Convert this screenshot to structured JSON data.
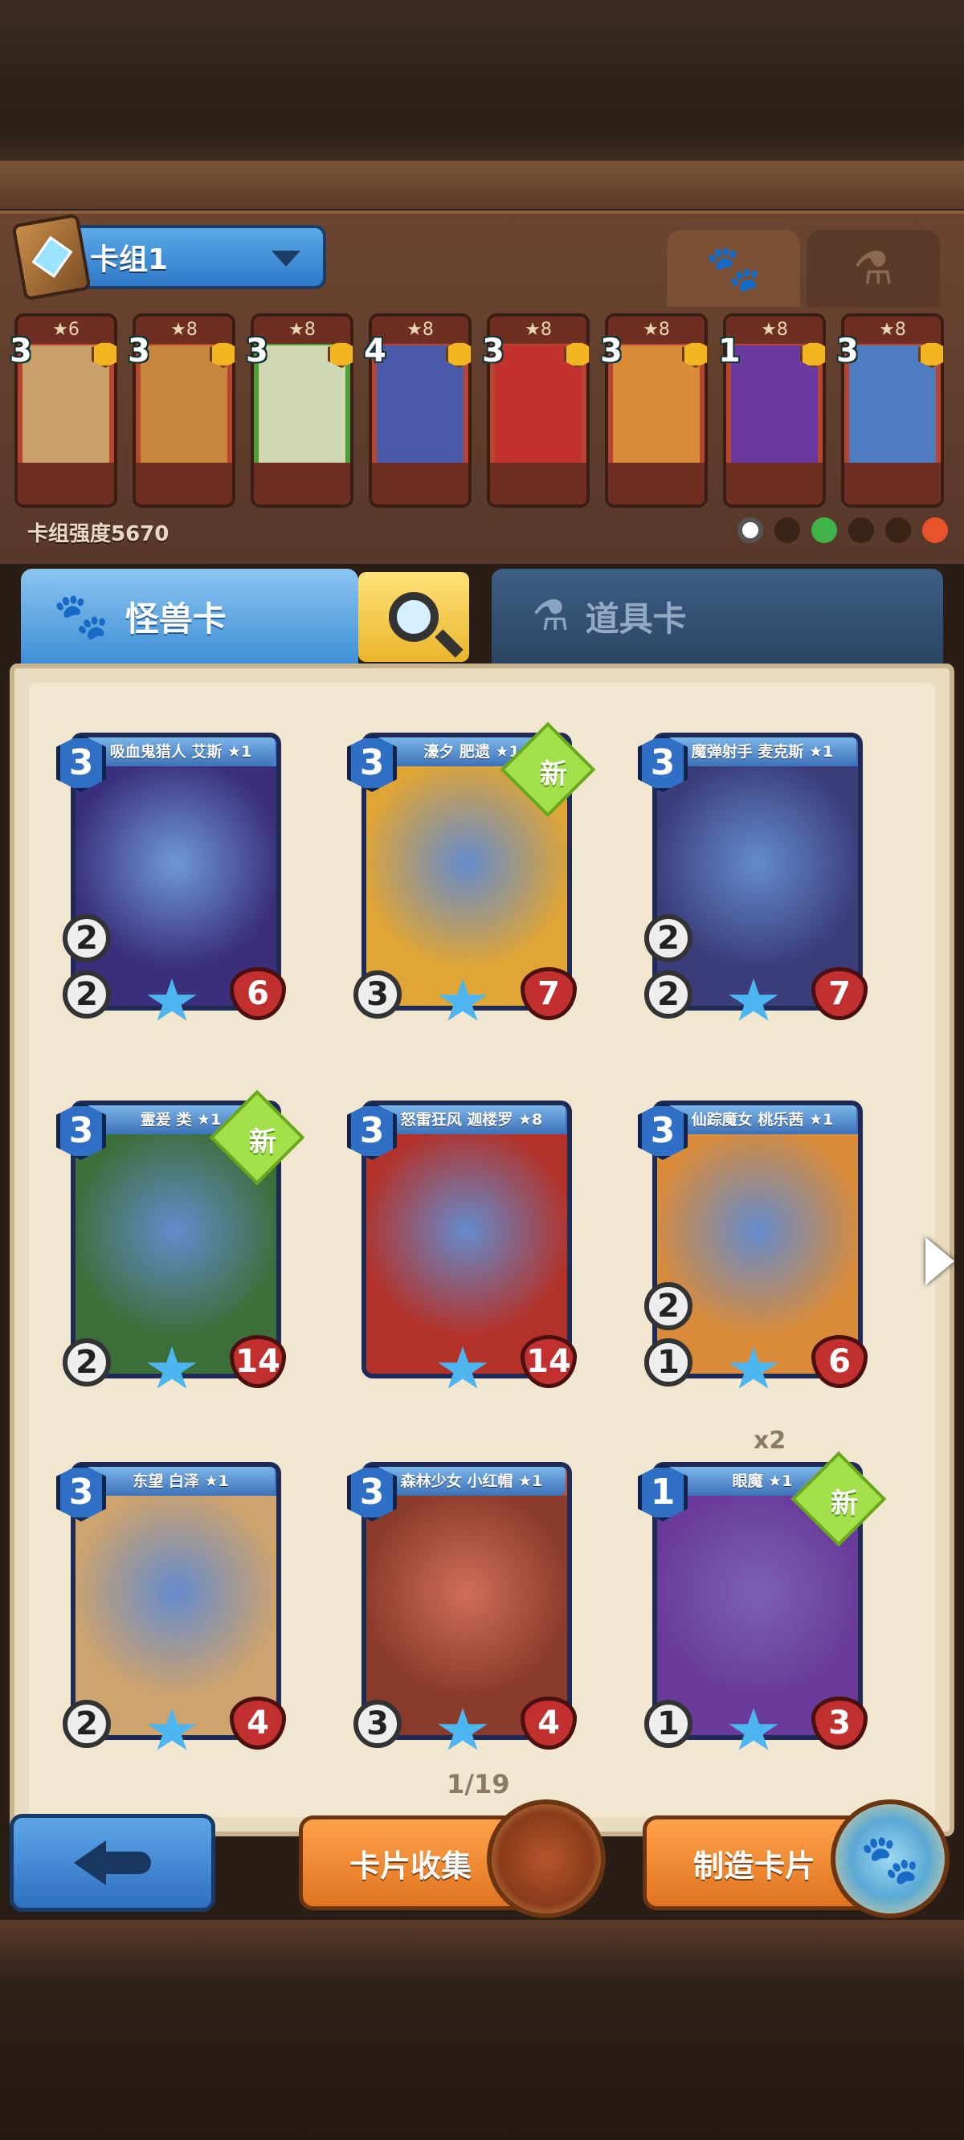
{
  "deck": {
    "name": "卡组1",
    "power_label": "卡组强度5670"
  },
  "deck_cards": [
    {
      "stars": "★6",
      "cost": "3",
      "bg": "#b8452f",
      "art": "#c9a06a"
    },
    {
      "stars": "★8",
      "cost": "3",
      "bg": "#b8452f",
      "art": "#c7873c"
    },
    {
      "stars": "★8",
      "cost": "3",
      "bg": "#4c9e35",
      "art": "#cfd7b3"
    },
    {
      "stars": "★8",
      "cost": "4",
      "bg": "#b8452f",
      "art": "#4a5aa8"
    },
    {
      "stars": "★8",
      "cost": "3",
      "bg": "#b8452f",
      "art": "#c3322f"
    },
    {
      "stars": "★8",
      "cost": "3",
      "bg": "#b8452f",
      "art": "#d98b3a"
    },
    {
      "stars": "★8",
      "cost": "1",
      "bg": "#b8452f",
      "art": "#6a3aa0"
    },
    {
      "stars": "★8",
      "cost": "3",
      "bg": "#b8452f",
      "art": "#4e7cc0"
    }
  ],
  "tabs": {
    "monster": "怪兽卡",
    "item": "道具卡"
  },
  "cards": [
    {
      "name": "吸血鬼猎人 艾斯 ★1",
      "cost": "3",
      "atk": "2",
      "def": "2",
      "hp": "6",
      "art": "#3a2f7a",
      "frame": "#4b7fd0",
      "new": false
    },
    {
      "name": "濠夕 肥遗 ★1",
      "cost": "3",
      "atk": "",
      "def": "3",
      "hp": "7",
      "art": "#e0a535",
      "frame": "#3e6ec0",
      "new": true
    },
    {
      "name": "魔弹射手 麦克斯 ★1",
      "cost": "3",
      "atk": "2",
      "def": "2",
      "hp": "7",
      "art": "#3a3d7a",
      "frame": "#3e6ec0",
      "new": false
    },
    {
      "name": "霊爰 类 ★1",
      "cost": "3",
      "atk": "",
      "def": "2",
      "hp": "14",
      "art": "#3c6e3a",
      "frame": "#3e6ec0",
      "new": true
    },
    {
      "name": "怒雷狂风 迦楼罗 ★8",
      "cost": "3",
      "atk": "",
      "def": "",
      "hp": "14",
      "art": "#b2322a",
      "frame": "#3e6ec0",
      "new": false
    },
    {
      "name": "仙踪魔女 桃乐茜 ★1",
      "cost": "3",
      "atk": "2",
      "def": "1",
      "hp": "6",
      "art": "#d98b3a",
      "frame": "#3e6ec0",
      "new": false
    },
    {
      "name": "东望 白泽 ★1",
      "cost": "3",
      "atk": "",
      "def": "2",
      "hp": "4",
      "art": "#cfa36d",
      "frame": "#3e6ec0",
      "new": false
    },
    {
      "name": "森林少女 小红帽 ★1",
      "cost": "3",
      "atk": "",
      "def": "3",
      "hp": "4",
      "art": "#8a3a2a",
      "frame": "#c24a32",
      "new": false
    },
    {
      "name": "眼魔 ★1",
      "cost": "1",
      "atk": "",
      "def": "1",
      "hp": "3",
      "art": "#6a3a9a",
      "frame": "#5b3aa0",
      "new": true
    }
  ],
  "new_label": "新",
  "extra_count": "x2",
  "pager": "1/19",
  "buttons": {
    "collect": "卡片收集",
    "craft": "制造卡片"
  }
}
